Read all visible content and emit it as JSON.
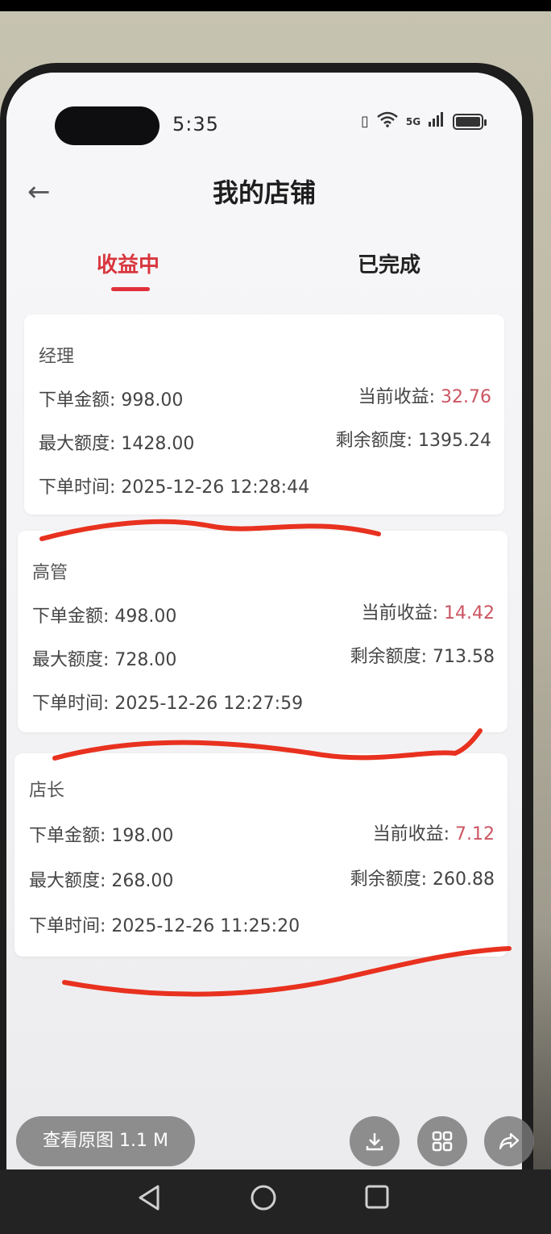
{
  "status": {
    "time": "5:35",
    "signal": "5G"
  },
  "header": {
    "back": "←",
    "title": "我的店铺"
  },
  "tabs": [
    {
      "label": "收益中",
      "active": true
    },
    {
      "label": "已完成",
      "active": false
    }
  ],
  "labels": {
    "order_amount": "下单金额: ",
    "max_quota": "最大额度: ",
    "order_time": "下单时间: ",
    "current_earnings": "当前收益: ",
    "remaining_quota": "剩余额度: "
  },
  "cards": [
    {
      "title": "经理",
      "order_amount": "998.00",
      "current_earnings": "32.76",
      "max_quota": "1428.00",
      "remaining_quota": "1395.24",
      "order_time": "2025-12-26 12:28:44"
    },
    {
      "title": "高管",
      "order_amount": "498.00",
      "current_earnings": "14.42",
      "max_quota": "728.00",
      "remaining_quota": "713.58",
      "order_time": "2025-12-26 12:27:59"
    },
    {
      "title": "店长",
      "order_amount": "198.00",
      "current_earnings": "7.12",
      "max_quota": "268.00",
      "remaining_quota": "260.88",
      "order_time": "2025-12-26 11:25:20"
    }
  ],
  "viewer": {
    "view_original": "查看原图 1.1 M"
  },
  "colors": {
    "accent": "#d9363e",
    "earnings": "#cc5562",
    "scribble": "#e8311f"
  }
}
